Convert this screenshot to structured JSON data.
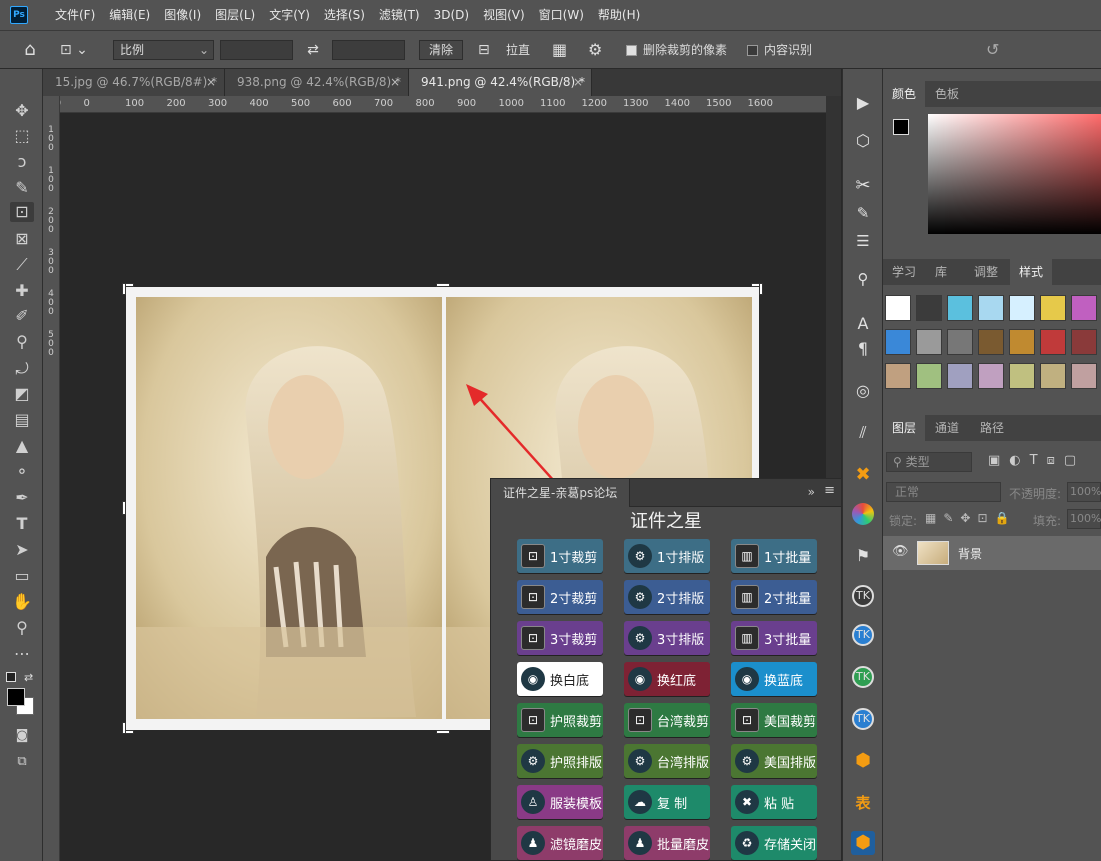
{
  "app": {
    "logo": "Ps"
  },
  "menu": [
    "文件(F)",
    "编辑(E)",
    "图像(I)",
    "图层(L)",
    "文字(Y)",
    "选择(S)",
    "滤镜(T)",
    "3D(D)",
    "视图(V)",
    "窗口(W)",
    "帮助(H)"
  ],
  "options": {
    "ratio_select": "比例",
    "clear_button": "清除",
    "straighten_label": "拉直",
    "delete_cropped_label": "删除裁剪的像素",
    "delete_cropped_checked": true,
    "content_aware_label": "内容识别",
    "content_aware_checked": false
  },
  "tabs": [
    {
      "label": "15.jpg @ 46.7%(RGB/8#) *",
      "active": false
    },
    {
      "label": "938.png @ 42.4%(RGB/8) *",
      "active": false
    },
    {
      "label": "941.png @ 42.4%(RGB/8) *",
      "active": true
    }
  ],
  "ruler_h": [
    "100",
    "0",
    "100",
    "200",
    "300",
    "400",
    "500",
    "600",
    "700",
    "800",
    "900",
    "1000",
    "1100",
    "1200",
    "1300",
    "1400",
    "1500",
    "1600"
  ],
  "ruler_v": [
    "1",
    "0",
    "0",
    "1",
    "0",
    "0",
    "2",
    "0",
    "0",
    "3",
    "0",
    "0",
    "4",
    "0",
    "0",
    "5",
    "0",
    "0"
  ],
  "color_panel": {
    "tabs": [
      "颜色",
      "色板"
    ],
    "active": 0
  },
  "styles_panel": {
    "tabs": [
      "学习",
      "库",
      "调整",
      "样式"
    ],
    "active": 3
  },
  "layers_panel": {
    "tabs": [
      "图层",
      "通道",
      "路径"
    ],
    "active": 0,
    "filter_label": "类型",
    "blend_mode": "正常",
    "opacity_label": "不透明度:",
    "opacity_value": "100%",
    "lock_label": "锁定:",
    "fill_label": "填充:",
    "fill_value": "100%",
    "layer_name": "背景"
  },
  "plugin": {
    "title": "证件之星-亲葛ps论坛",
    "heading": "证件之星",
    "buttons": [
      {
        "label": "1寸裁剪",
        "color": "#3d6e86",
        "icon": "crop-icon"
      },
      {
        "label": "1寸排版",
        "color": "#3d6e86",
        "icon": "layout-icon"
      },
      {
        "label": "1寸批量",
        "color": "#3d6e86",
        "icon": "batch-icon"
      },
      {
        "label": "2寸裁剪",
        "color": "#3c5d93",
        "icon": "crop-icon"
      },
      {
        "label": "2寸排版",
        "color": "#3c5d93",
        "icon": "layout-icon"
      },
      {
        "label": "2寸批量",
        "color": "#3c5d93",
        "icon": "batch-icon"
      },
      {
        "label": "3寸裁剪",
        "color": "#6a3f8e",
        "icon": "crop-icon"
      },
      {
        "label": "3寸排版",
        "color": "#6a3f8e",
        "icon": "layout-icon"
      },
      {
        "label": "3寸批量",
        "color": "#6a3f8e",
        "icon": "batch-icon"
      },
      {
        "label": "换白底",
        "color": "#ffffff",
        "icon": "white-bg-icon",
        "text": "#222222"
      },
      {
        "label": "换红底",
        "color": "#7e2234",
        "icon": "red-bg-icon"
      },
      {
        "label": "换蓝底",
        "color": "#1b8fcc",
        "icon": "blue-bg-icon"
      },
      {
        "label": "护照裁剪",
        "color": "#2e7a43",
        "icon": "crop-icon"
      },
      {
        "label": "台湾裁剪",
        "color": "#2e7a43",
        "icon": "crop-icon"
      },
      {
        "label": "美国裁剪",
        "color": "#2e7a43",
        "icon": "crop-icon"
      },
      {
        "label": "护照排版",
        "color": "#4b7632",
        "icon": "layout-icon"
      },
      {
        "label": "台湾排版",
        "color": "#4b7632",
        "icon": "layout-icon"
      },
      {
        "label": "美国排版",
        "color": "#4b7632",
        "icon": "layout-icon"
      },
      {
        "label": "服装模板",
        "color": "#8a3a86",
        "icon": "clothes-icon"
      },
      {
        "label": "复 制",
        "color": "#1e8a6a",
        "icon": "copy-icon"
      },
      {
        "label": "粘 贴",
        "color": "#1e8a6a",
        "icon": "paste-icon"
      },
      {
        "label": "滤镜磨皮",
        "color": "#8e3c6a",
        "icon": "filter-icon"
      },
      {
        "label": "批量磨皮",
        "color": "#8e3c6a",
        "icon": "filter-icon"
      },
      {
        "label": "存储关闭",
        "color": "#1e8a6a",
        "icon": "save-close-icon"
      }
    ]
  }
}
